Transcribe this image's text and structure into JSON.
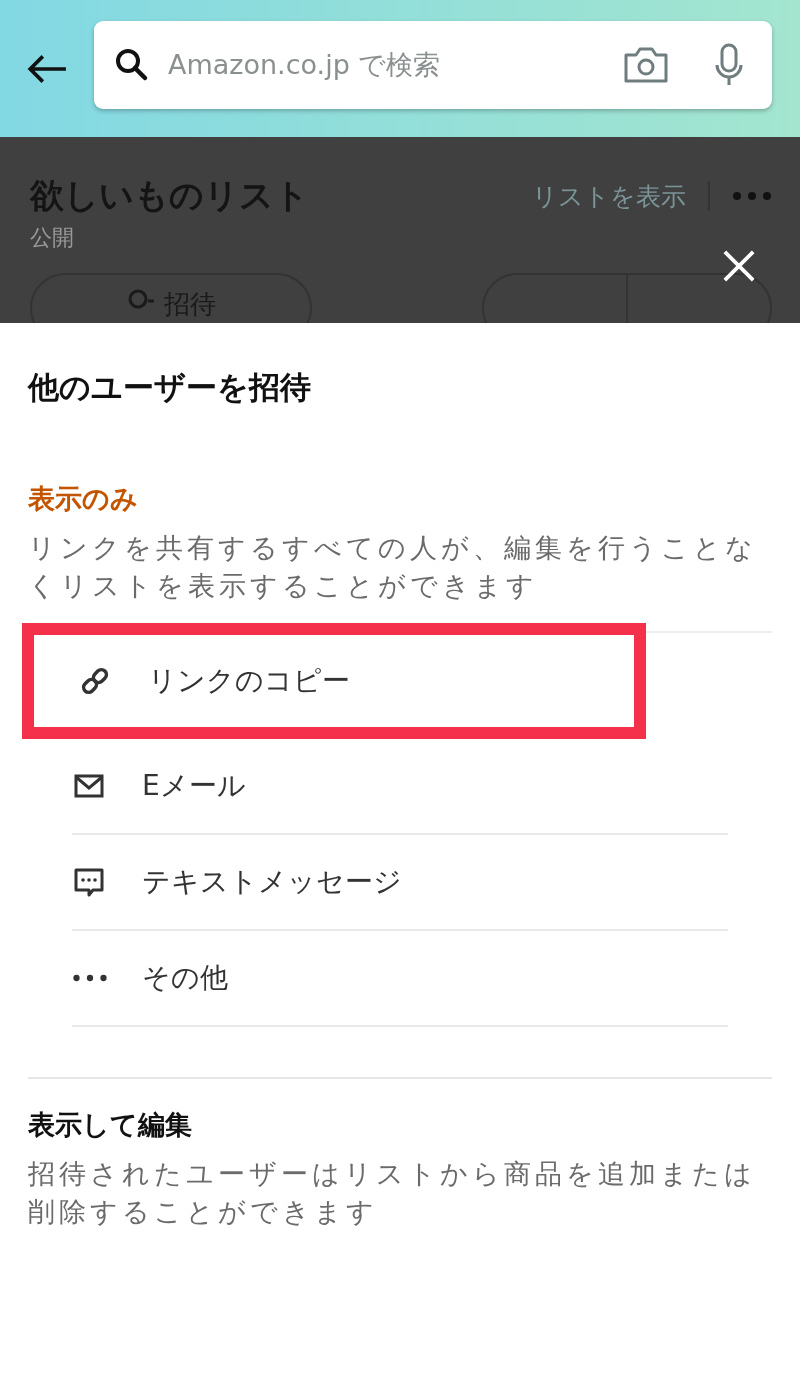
{
  "search": {
    "placeholder": "Amazon.co.jp で検索"
  },
  "list_header": {
    "title": "欲しいものリスト",
    "visibility": "公開",
    "view_link": "リストを表示",
    "invite_button": "招待"
  },
  "sheet": {
    "title": "他のユーザーを招待",
    "sections": [
      {
        "heading": "表示のみ",
        "accent": true,
        "description": "リンクを共有するすべての人が、編集を行うことなくリストを表示することができます",
        "options": [
          {
            "kind": "link",
            "label": "リンクのコピー",
            "highlighted": true
          },
          {
            "kind": "email",
            "label": "Eメール",
            "highlighted": false
          },
          {
            "kind": "sms",
            "label": "テキストメッセージ",
            "highlighted": false
          },
          {
            "kind": "more",
            "label": "その他",
            "highlighted": false
          }
        ]
      },
      {
        "heading": "表示して編集",
        "accent": false,
        "description": "招待されたユーザーはリストから商品を追加または削除することができます"
      }
    ]
  }
}
